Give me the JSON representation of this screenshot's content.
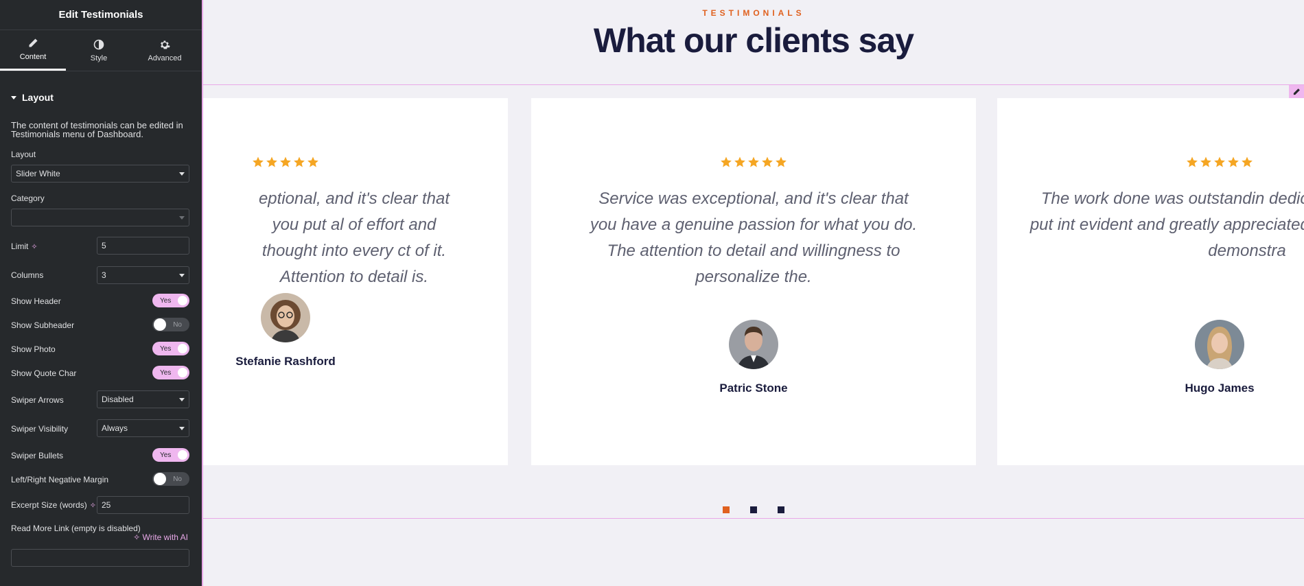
{
  "sidebar": {
    "title": "Edit Testimonials",
    "tabs": [
      {
        "label": "Content",
        "icon": "pencil-icon"
      },
      {
        "label": "Style",
        "icon": "half-circle-icon"
      },
      {
        "label": "Advanced",
        "icon": "gear-icon"
      }
    ],
    "section_title": "Layout",
    "note": "The content of testimonials can be edited in Testimonials menu of Dashboard.",
    "layout": {
      "label": "Layout",
      "value": "Slider White"
    },
    "category": {
      "label": "Category",
      "value": ""
    },
    "limit": {
      "label": "Limit",
      "value": "5"
    },
    "columns": {
      "label": "Columns",
      "value": "3"
    },
    "show_header": {
      "label": "Show Header",
      "state": "Yes"
    },
    "show_subheader": {
      "label": "Show Subheader",
      "state": "No"
    },
    "show_photo": {
      "label": "Show Photo",
      "state": "Yes"
    },
    "show_quote_char": {
      "label": "Show Quote Char",
      "state": "Yes"
    },
    "swiper_arrows": {
      "label": "Swiper Arrows",
      "value": "Disabled"
    },
    "swiper_visibility": {
      "label": "Swiper Visibility",
      "value": "Always"
    },
    "swiper_bullets": {
      "label": "Swiper Bullets",
      "state": "Yes"
    },
    "negative_margin": {
      "label": "Left/Right Negative Margin",
      "state": "No"
    },
    "excerpt_size": {
      "label": "Excerpt Size (words)",
      "value": "25"
    },
    "read_more": {
      "label": "Read More Link (empty is disabled)",
      "write_ai": "Write with AI",
      "value": ""
    }
  },
  "canvas": {
    "eyebrow": "TESTIMONIALS",
    "headline": "What our clients say",
    "testimonials": [
      {
        "quote": "eptional, and it's clear that you put al of effort and thought into every ct of it. Attention to detail is.",
        "name": "Stefanie Rashford"
      },
      {
        "quote": "Service was exceptional, and it's clear that you have a genuine passion for what you do. The attention to detail and willingness to personalize the.",
        "name": "Patric Stone"
      },
      {
        "quote": "The work done was outstandin dedication and hard work put int evident and greatly appreciated. T skill and expertise demonstra",
        "name": "Hugo James"
      }
    ],
    "colors": {
      "accent": "#e0611f",
      "heading": "#1a1c3d",
      "star": "#f5a623",
      "active_dot": "#e0611f",
      "inactive_dot": "#1a1c3d"
    }
  }
}
